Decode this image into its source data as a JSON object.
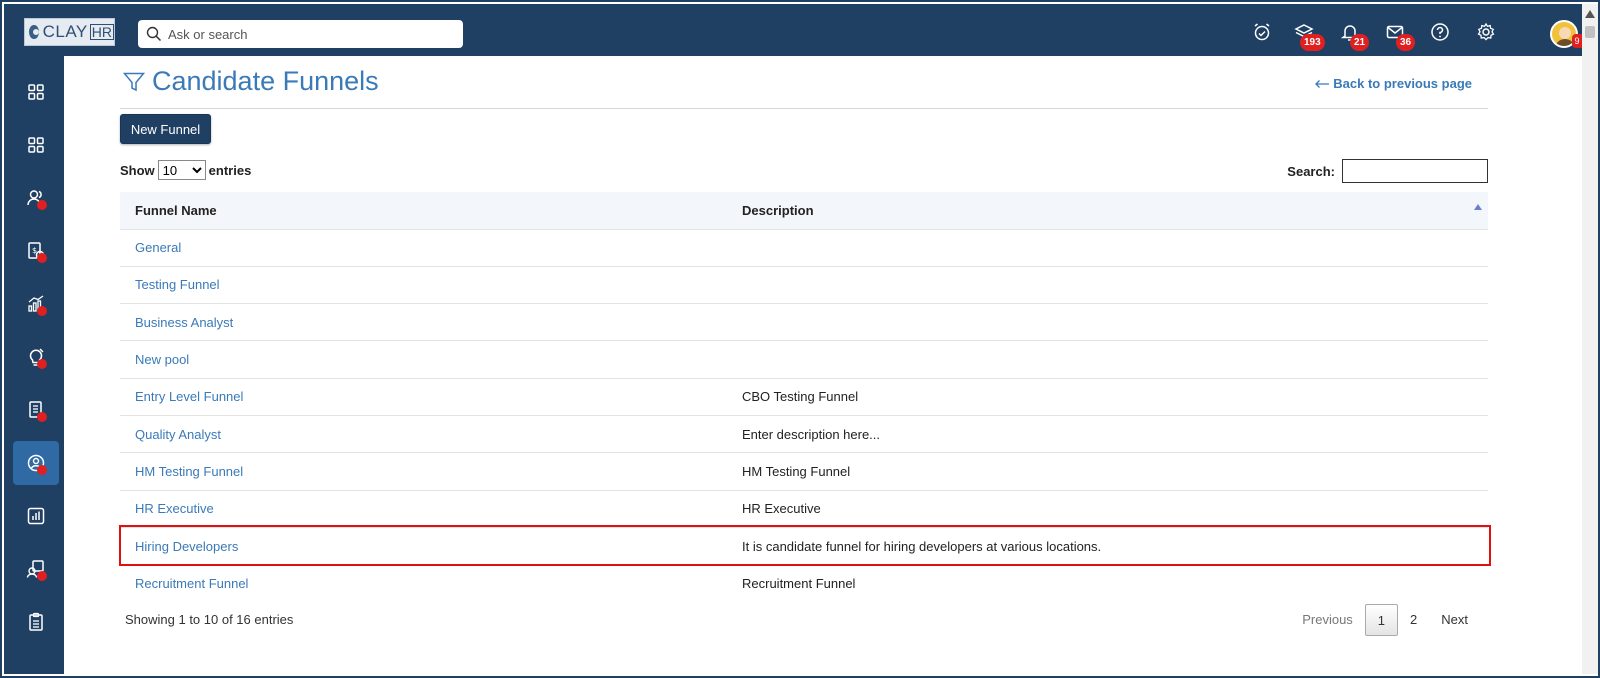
{
  "app": {
    "logo_text": "CLAY",
    "logo_suffix": "HR"
  },
  "topbar": {
    "search_placeholder": "Ask or search",
    "icons": [
      {
        "name": "alarm-clock-icon"
      },
      {
        "name": "layers-icon",
        "badge": "193"
      },
      {
        "name": "bell-icon",
        "badge": "21"
      },
      {
        "name": "mail-icon",
        "badge": "36"
      },
      {
        "name": "help-icon"
      },
      {
        "name": "gear-icon"
      }
    ],
    "avatar_badge": "9"
  },
  "sidebar": {
    "items": [
      {
        "name": "dashboard-grid-icon",
        "dot": false,
        "active": false
      },
      {
        "name": "apps-grid-icon",
        "dot": false,
        "active": false
      },
      {
        "name": "people-icon",
        "dot": true,
        "active": false
      },
      {
        "name": "payroll-icon",
        "dot": true,
        "active": false
      },
      {
        "name": "analytics-icon",
        "dot": true,
        "active": false
      },
      {
        "name": "idea-icon",
        "dot": true,
        "active": false
      },
      {
        "name": "documents-icon",
        "dot": true,
        "active": false
      },
      {
        "name": "recruitment-icon",
        "dot": true,
        "active": true
      },
      {
        "name": "reports-chart-icon",
        "dot": false,
        "active": false
      },
      {
        "name": "support-icon",
        "dot": true,
        "active": false
      },
      {
        "name": "clipboard-icon",
        "dot": false,
        "active": false
      }
    ]
  },
  "page": {
    "title": "Candidate Funnels",
    "back_link": "Back to previous page",
    "new_button": "New Funnel",
    "show_label": "Show",
    "entries_label": "entries",
    "page_size": "10",
    "search_label": "Search:",
    "search_value": ""
  },
  "table": {
    "columns": [
      "Funnel Name",
      "Description"
    ],
    "rows": [
      {
        "name": "General",
        "description": ""
      },
      {
        "name": "Testing Funnel",
        "description": ""
      },
      {
        "name": "Business Analyst",
        "description": ""
      },
      {
        "name": "New pool",
        "description": ""
      },
      {
        "name": "Entry Level Funnel",
        "description": "CBO Testing Funnel"
      },
      {
        "name": "Quality Analyst",
        "description": "Enter description here..."
      },
      {
        "name": "HM Testing Funnel",
        "description": "HM Testing Funnel"
      },
      {
        "name": "HR Executive",
        "description": "HR Executive"
      },
      {
        "name": "Hiring Developers",
        "description": "It is candidate funnel for hiring developers at various locations."
      },
      {
        "name": "Recruitment Funnel",
        "description": "Recruitment Funnel"
      }
    ],
    "highlighted_row": 8
  },
  "footer": {
    "info": "Showing 1 to 10 of 16 entries",
    "previous": "Previous",
    "pages": [
      "1",
      "2"
    ],
    "current_page": "1",
    "next": "Next"
  },
  "colors": {
    "nav": "#1f3f63",
    "link": "#3a7ab8",
    "badge": "#e02020",
    "highlight": "#e01010"
  }
}
